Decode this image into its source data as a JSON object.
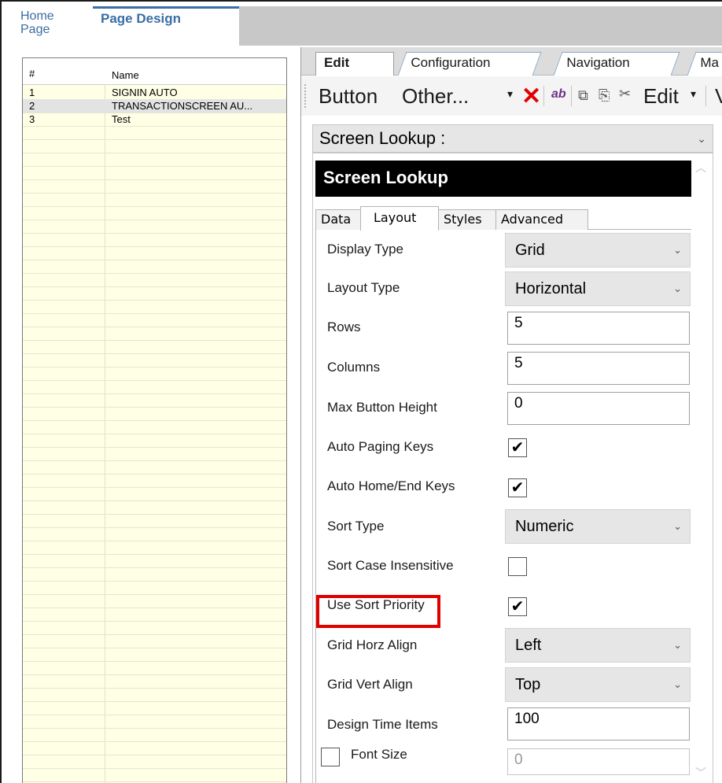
{
  "top_tabs": {
    "home": "Home Page",
    "page_design": "Page Design"
  },
  "list": {
    "header_num": "#",
    "header_name": "Name",
    "rows": [
      {
        "num": "1",
        "name": "SIGNIN AUTO"
      },
      {
        "num": "2",
        "name": "TRANSACTIONSCREEN AU..."
      },
      {
        "num": "3",
        "name": "Test"
      }
    ]
  },
  "second_tabs": {
    "edit": "Edit",
    "configuration": "Configuration",
    "navigation": "Navigation",
    "ma": "Ma"
  },
  "toolbar": {
    "button": "Button",
    "other": "Other...",
    "dropdown_arrow": "▾",
    "delete": "✕",
    "ab": "ab",
    "copy": "⧉",
    "paste": "⎘",
    "cut": "✂",
    "edit": "Edit",
    "v": "V"
  },
  "screen_select": {
    "value": "Screen Lookup :",
    "chevron": "⌄"
  },
  "panel": {
    "title": "Screen Lookup",
    "tabs": {
      "data": "Data",
      "layout": "Layout",
      "styles": "Styles",
      "advanced": "Advanced"
    },
    "properties": {
      "display_type": {
        "label": "Display Type",
        "value": "Grid"
      },
      "layout_type": {
        "label": "Layout Type",
        "value": "Horizontal"
      },
      "rows": {
        "label": "Rows",
        "value": "5"
      },
      "columns": {
        "label": "Columns",
        "value": "5"
      },
      "max_button_height": {
        "label": "Max Button Height",
        "value": "0"
      },
      "auto_paging_keys": {
        "label": "Auto Paging Keys",
        "checked": "✔"
      },
      "auto_home_end_keys": {
        "label": "Auto Home/End Keys",
        "checked": "✔"
      },
      "sort_type": {
        "label": "Sort Type",
        "value": "Numeric"
      },
      "sort_case_insensitive": {
        "label": "Sort Case Insensitive",
        "checked": ""
      },
      "use_sort_priority": {
        "label": "Use Sort Priority",
        "checked": "✔"
      },
      "grid_horz_align": {
        "label": "Grid Horz Align",
        "value": "Left"
      },
      "grid_vert_align": {
        "label": "Grid Vert Align",
        "value": "Top"
      },
      "design_time_items": {
        "label": "Design Time Items",
        "value": "100"
      },
      "font_size": {
        "label": "Font Size",
        "value": "0"
      }
    },
    "chevron": "⌄"
  },
  "colors": {
    "highlight": "#e00000",
    "accent": "#3a6ea5",
    "list_bg": "#ffffe6"
  }
}
